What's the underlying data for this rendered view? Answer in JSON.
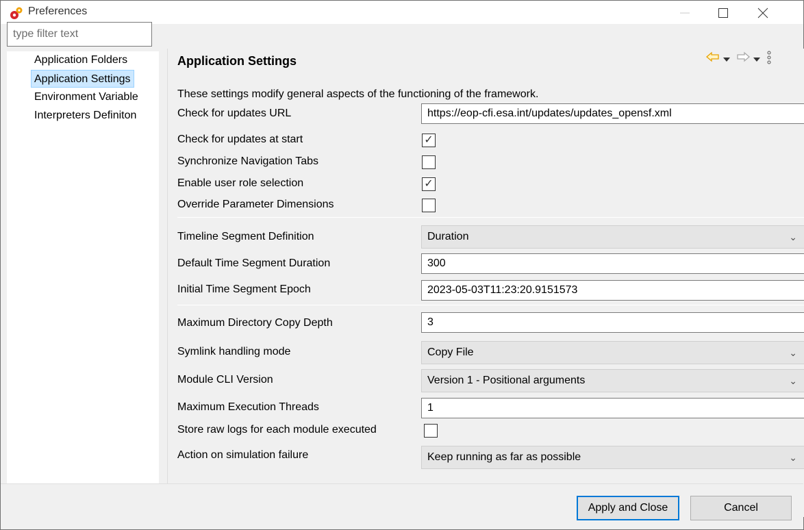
{
  "window": {
    "title": "Preferences",
    "app_icon": "preferences-gear-icon"
  },
  "left": {
    "filter_placeholder": "type filter text",
    "items": [
      {
        "label": "Application Folders"
      },
      {
        "label": "Application Settings"
      },
      {
        "label": "Environment Variable"
      },
      {
        "label": "Interpreters Definiton"
      }
    ],
    "selected_index": 1
  },
  "main": {
    "title": "Application Settings",
    "description": "These settings modify general aspects of the functioning of the framework.",
    "fields": {
      "updates_url": {
        "label": "Check for updates URL",
        "value": "https://eop-cfi.esa.int/updates/updates_opensf.xml"
      },
      "check_updates_start": {
        "label": "Check for updates at start",
        "checked": true
      },
      "sync_nav_tabs": {
        "label": "Synchronize Navigation Tabs",
        "checked": false
      },
      "enable_user_role": {
        "label": "Enable user role selection",
        "checked": true
      },
      "override_param_dims": {
        "label": "Override Parameter Dimensions",
        "checked": false
      },
      "timeline_segment_def": {
        "label": "Timeline Segment Definition",
        "value": "Duration"
      },
      "default_time_seg_dur": {
        "label": "Default Time Segment Duration",
        "value": "300"
      },
      "initial_time_seg_epoch": {
        "label": "Initial Time Segment Epoch",
        "value": "2023-05-03T11:23:20.9151573"
      },
      "max_dir_copy_depth": {
        "label": "Maximum Directory Copy Depth",
        "value": "3"
      },
      "symlink_mode": {
        "label": "Symlink handling mode",
        "value": "Copy File"
      },
      "module_cli_version": {
        "label": "Module CLI Version",
        "value": "Version 1 - Positional arguments"
      },
      "max_exec_threads": {
        "label": "Maximum Execution Threads",
        "value": "1"
      },
      "store_raw_logs": {
        "label": "Store raw logs for each module executed",
        "checked": false
      },
      "action_sim_failure": {
        "label": "Action on simulation failure",
        "value": "Keep running as far as possible"
      }
    }
  },
  "footer": {
    "apply_close": "Apply and Close",
    "cancel": "Cancel"
  },
  "colors": {
    "accent": "#0078d7",
    "selection": "#cce8ff",
    "nav_back": "#e8a200"
  }
}
